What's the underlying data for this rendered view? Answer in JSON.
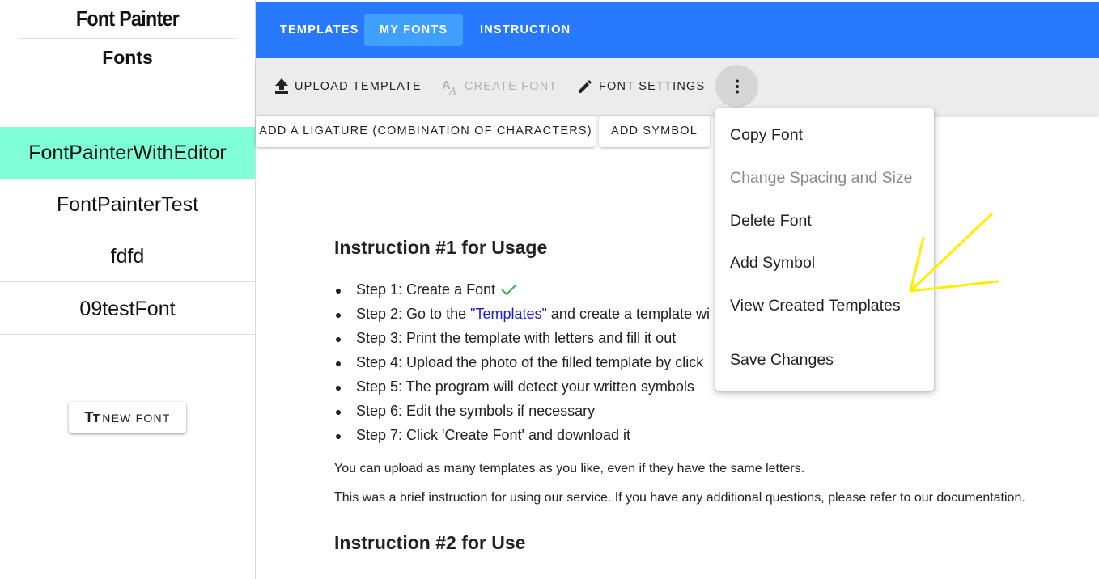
{
  "sidebar": {
    "brand": "Font Painter",
    "heading": "Fonts",
    "fonts": [
      {
        "label": "FontPainterWithEditor",
        "active": true
      },
      {
        "label": "FontPainterTest",
        "active": false
      },
      {
        "label": "fdfd",
        "active": false
      },
      {
        "label": "09testFont",
        "active": false
      }
    ],
    "new_font_label": "NEW FONT",
    "new_font_icon": "text-fields-icon"
  },
  "topbar": {
    "tabs": [
      {
        "label": "TEMPLATES",
        "active": false
      },
      {
        "label": "MY FONTS",
        "active": true
      },
      {
        "label": "INSTRUCTION",
        "active": false
      }
    ],
    "color": "#2979ff",
    "active_tab_color": "#40a0ff"
  },
  "toolbar": {
    "upload_label": "UPLOAD TEMPLATE",
    "upload_icon": "upload-icon",
    "create_label": "CREATE FONT",
    "create_icon": "font-glyph-icon",
    "create_disabled": true,
    "settings_label": "FONT SETTINGS",
    "settings_icon": "pencil-icon",
    "more_icon": "more-vertical-icon"
  },
  "actions": {
    "ligature_label": "ADD A LIGATURE (COMBINATION OF CHARACTERS)",
    "symbol_label": "ADD SYMBOL"
  },
  "menu": {
    "items": [
      {
        "label": "Copy Font",
        "disabled": false
      },
      {
        "label": "Change Spacing and Size",
        "disabled": true
      },
      {
        "label": "Delete Font",
        "disabled": false
      },
      {
        "label": "Add Symbol",
        "disabled": false
      },
      {
        "label": "View Created Templates",
        "disabled": false
      }
    ],
    "footer_item": "Save Changes"
  },
  "content": {
    "title1": "Instruction #1 for Usage",
    "steps": {
      "s1": "Step 1: Create a Font",
      "s2_pre": "Step 2: Go to the ",
      "s2_link": "\"Templates\"",
      "s2_post": " and create a template wi",
      "s3": "Step 3: Print the template with letters and fill it out",
      "s4": "Step 4: Upload the photo of the filled template by click",
      "s5": "Step 5: The program will detect your written symbols",
      "s6": "Step 6: Edit the symbols if necessary",
      "s7": "Step 7: Click 'Create Font' and download it"
    },
    "check_icon": "check-icon",
    "check_color": "#4caf50",
    "para1": "You can upload as many templates as you like, even if they have the same letters.",
    "para2": "This was a brief instruction for using our service. If you have any additional questions, please refer to our documentation.",
    "title2": "Instruction #2 for Use"
  },
  "annotation": {
    "icon": "arrow-annotation-icon",
    "color": "#ffee00"
  },
  "colors": {
    "active_font_bg": "#80ffd6",
    "link": "#1a1adb"
  }
}
